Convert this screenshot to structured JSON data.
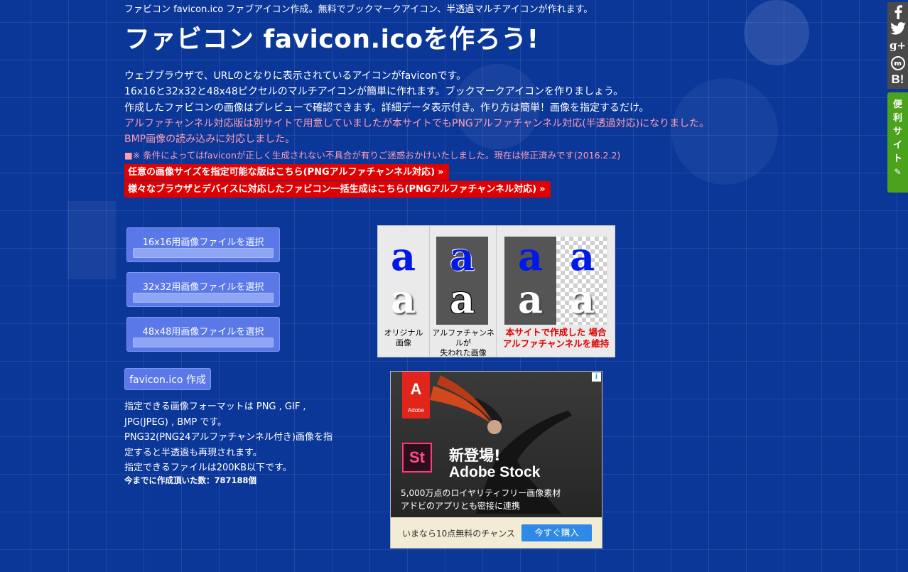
{
  "tagline": "ファビコン favicon.ico ファブアイコン作成。無料でブックマークアイコン、半透過マルチアイコンが作れます。",
  "title": "ファビコン favicon.icoを作ろう!",
  "intro": {
    "line1": "ウェブブラウザで、URLのとなりに表示されているアイコンがfaviconです。",
    "line2": "16x16と32x32と48x48ピクセルのマルチアイコンが簡単に作れます。ブックマークアイコンを作りましょう。",
    "line3": "作成したファビコンの画像はプレビューで確認できます。詳細データ表示付き。作り方は簡単！画像を指定するだけ。",
    "line4": "アルファチャンネル対応版は別サイトで用意していましたが本サイトでもPNGアルファチャンネル対応(半透過対応)になりました。",
    "line5": "BMP画像の読み込みに対応しました。"
  },
  "notice": "■※ 条件によってはfaviconが正しく生成されない不具合が有りご迷惑おかけいたしました。現在は修正済みです(2016.2.2)",
  "links": {
    "custom_size": "任意の画像サイズを指定可能な版はこちら(PNGアルファチャンネル対応)",
    "all_devices": "様々なブラウザとデバイスに対応したファビコン一括生成はこちら(PNGアルファチャンネル対応)",
    "arrow": "»"
  },
  "file_inputs": [
    {
      "label": "16x16用画像ファイルを選択"
    },
    {
      "label": "32x32用画像ファイルを選択"
    },
    {
      "label": "48x48用画像ファイルを選択"
    }
  ],
  "create_button": "favicon.ico 作成",
  "formats_info": {
    "l1": "指定できる画像フォーマットは PNG , GIF ,",
    "l2": "JPG(JPEG) , BMP です。",
    "l3": "PNG32(PNG24アルファチャンネル付き)画像を指",
    "l4": "定すると半透過も再現されます。",
    "l5": "指定できるファイルは200KB以下です。"
  },
  "count": {
    "label": "今までに作成頂いた数：",
    "value": "787188",
    "unit": "個"
  },
  "preview": {
    "glyph": "a",
    "original": {
      "l1": "オリジナル",
      "l2": "画像"
    },
    "lost": {
      "l1": "アルファチャンネルが",
      "l2": "失われた画像"
    },
    "kept": {
      "l1": "本サイトで作成した 場合",
      "l2": "アルファチャンネルを維持"
    }
  },
  "ad": {
    "logo_text": "Adobe",
    "st": "St",
    "headline1": "新登場!",
    "headline2": "Adobe Stock",
    "sub1": "5,000万点のロイヤリティフリー画像素材",
    "sub2": "アドビのアプリとも密接に連携",
    "bar_text": "いまなら10点無料のチャンス",
    "button": "今すぐ購入",
    "info": "i"
  },
  "social": {
    "icons": [
      "facebook-icon",
      "twitter-icon",
      "google-plus-icon",
      "mixi-icon",
      "hatena-bookmark-icon"
    ],
    "gplus": "g+",
    "hatena": "B!"
  },
  "side_tab": {
    "l1": "便",
    "l2": "利",
    "l3": "サ",
    "l4": "イ",
    "l5": "ト",
    "l6": "✎"
  },
  "colors": {
    "background": "#0b3799",
    "accent_red": "#e10000",
    "pink_text": "#ff9db0",
    "button_blue": "#5a78e8",
    "side_tab_green": "#4ba21d"
  }
}
